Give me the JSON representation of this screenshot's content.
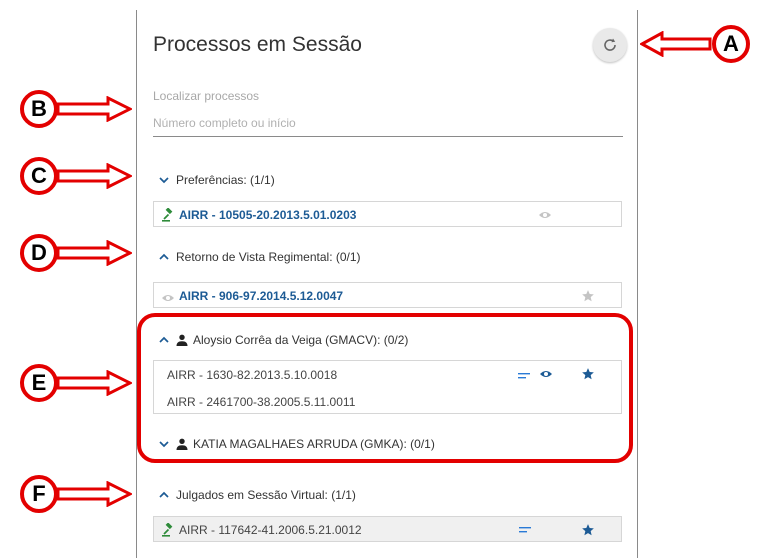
{
  "panel": {
    "title": "Processos em Sessão",
    "refresh_icon": "refresh-icon"
  },
  "search": {
    "label": "Localizar processos",
    "placeholder": "Número completo ou início",
    "value": ""
  },
  "groups": [
    {
      "label": "Preferências: (1/1)",
      "expanded": true
    },
    {
      "label": "Retorno de Vista Regimental: (0/1)",
      "expanded": false
    },
    {
      "label": "Aloysio Corrêa da Veiga (GMACV): (0/2)",
      "expanded": false
    },
    {
      "label": "KATIA MAGALHAES ARRUDA (GMKA): (0/1)",
      "expanded": true
    },
    {
      "label": "Julgados em Sessão Virtual: (1/1)",
      "expanded": false
    }
  ],
  "items": {
    "pref": "AIRR - 10505-20.2013.5.01.0203",
    "retorno": "AIRR - 906-97.2014.5.12.0047",
    "aloysio_1": "AIRR - 1630-82.2013.5.10.0018",
    "aloysio_2": "AIRR - 2461700-38.2005.5.11.0011",
    "julgados": "AIRR - 117642-41.2006.5.21.0012"
  },
  "annotations": {
    "a": "A",
    "b": "B",
    "c": "C",
    "d": "D",
    "e": "E",
    "f": "F"
  },
  "colors": {
    "link": "#1d5b95",
    "gavel": "#2e8b3a",
    "annotation": "#e30000",
    "muted_icon": "#c4c4c4"
  }
}
